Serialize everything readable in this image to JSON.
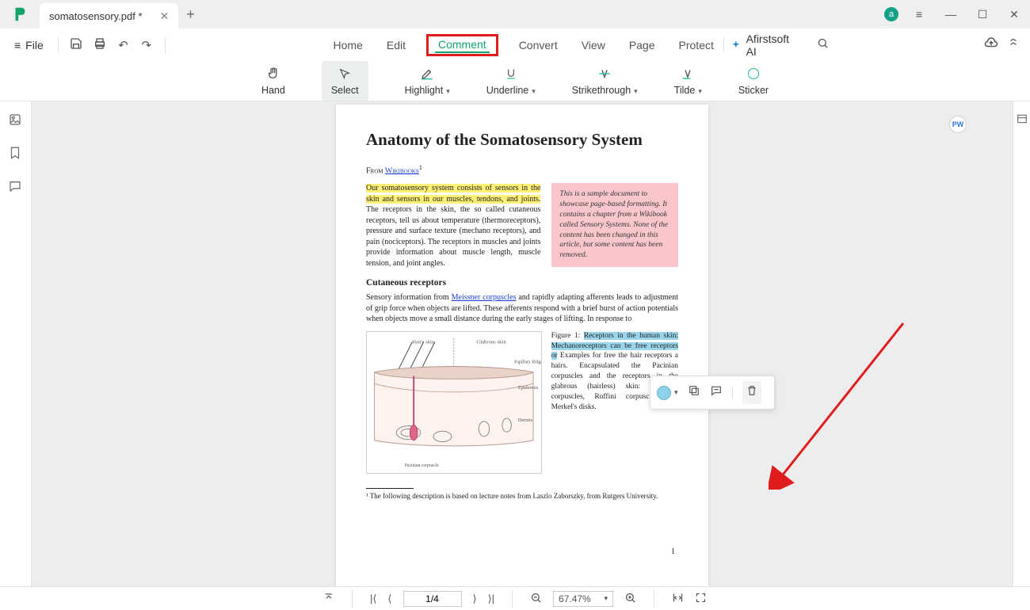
{
  "titlebar": {
    "tab_title": "somatosensory.pdf *",
    "user_initial": "a"
  },
  "menubar": {
    "file": "File",
    "tabs": [
      "Home",
      "Edit",
      "Comment",
      "Convert",
      "View",
      "Page",
      "Protect"
    ],
    "active_tab": "Comment",
    "ai_label": "Afirstsoft AI"
  },
  "ribbon": {
    "hand": "Hand",
    "select": "Select",
    "highlight": "Highlight",
    "underline": "Underline",
    "strike": "Strikethrough",
    "tilde": "Tilde",
    "sticker": "Sticker"
  },
  "document": {
    "title": "Anatomy of the Somatosensory System",
    "from_prefix": "From ",
    "from_link": "Wikibooks",
    "para1_hl": "Our somatosensory system consists of sensors in the skin and sensors in our muscles, tendons, and joints.",
    "para1_rest": " The receptors in the skin, the so called cutaneous receptors, tell us about temperature (thermoreceptors), pressure and surface texture (mechano receptors), and pain (nociceptors). The receptors in muscles and joints provide information about muscle length, muscle tension, and joint angles.",
    "pinkbox": "This is a sample document to showcase page-based formatting. It contains a chapter from a Wikibook called Sensory Systems. None of the content has been changed in this article, but some content has been removed.",
    "subhead": "Cutaneous receptors",
    "para2a": "Sensory information from ",
    "para2_link": "Meissner corpuscles",
    "para2b": " and rapidly adapting afferents leads to adjustment of grip force when objects are lifted. These afferents respond with a brief burst of action potentials when objects move a small distance during the early stages of lifting. In response to",
    "fig_caption_pre": "Figure 1: ",
    "fig_caption_hl": "Receptors in the human skin: Mechanoreceptors can be free receptors or",
    "fig_caption_rest": " Examples for free the hair receptors a hairs. Encapsulated the Pacinian corpuscles and the receptors in the glabrous (hairless) skin: Meissner corpuscles, Ruffini corpuscles and Merkel's disks.",
    "footnote": "¹ The following description is based on lecture notes from Laszlo Zaborszky, from Rutgers University.",
    "diagram_labels": {
      "hairy": "Hairy skin",
      "glabrous": "Glabrous skin",
      "papillary": "Papillary Ridges",
      "epidermis": "Epidermis",
      "dermis": "Dermis",
      "pacinian": "Pacinian corpuscle"
    },
    "page_number": "1"
  },
  "context_popup": {
    "color_icon": "color-swatch",
    "copy_icon": "copy",
    "comment_icon": "comment",
    "delete_icon": "delete"
  },
  "bottombar": {
    "page_display": "1/4",
    "zoom_display": "67.47%"
  }
}
